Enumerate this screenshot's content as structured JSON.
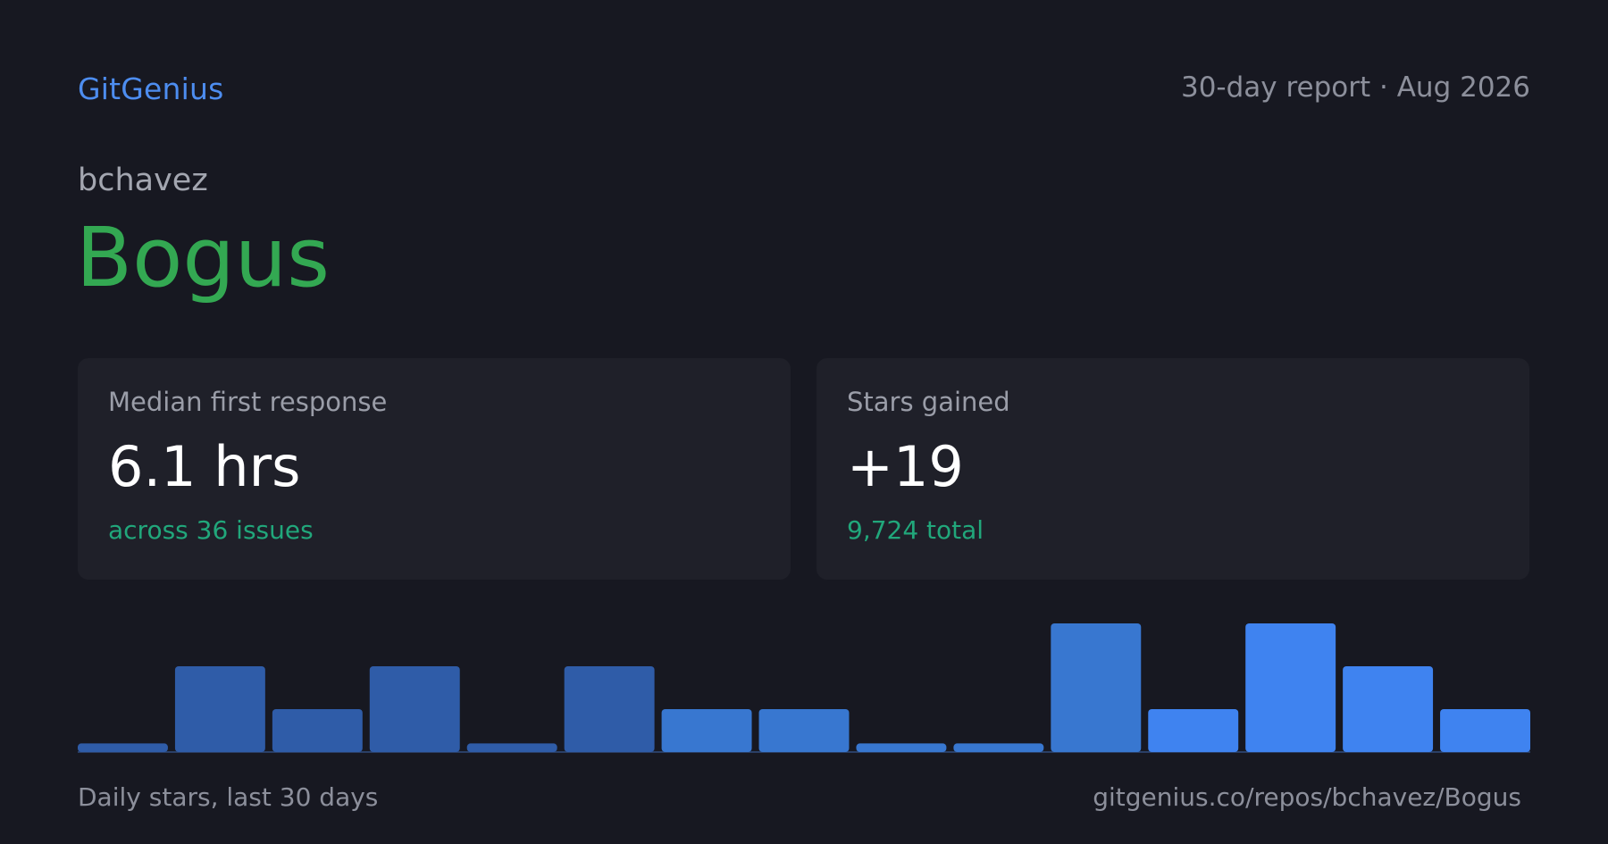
{
  "header": {
    "brand": "GitGenius",
    "report_label": "30-day report · Aug 2026"
  },
  "repo": {
    "owner": "bchavez",
    "name": "Bogus"
  },
  "stats": {
    "response": {
      "label": "Median first response",
      "value": "6.1 hrs",
      "sub": "across 36 issues"
    },
    "stars": {
      "label": "Stars gained",
      "value": "+19",
      "sub": "9,724 total"
    }
  },
  "footer": {
    "caption": "Daily stars, last 30 days",
    "url": "gitgenius.co/repos/bchavez/Bogus"
  },
  "colors": {
    "brand": "#4d8df0",
    "repo": "#33a852",
    "accent": "#21a77b",
    "bar_dark": "#2f5ca8",
    "bar_mid": "#3877d0",
    "bar_bright": "#3f83f0"
  },
  "chart_data": {
    "type": "bar",
    "values": [
      0.2,
      2,
      1,
      2,
      0.2,
      2,
      1,
      1,
      0.2,
      0.2,
      3,
      1,
      3,
      2,
      1
    ],
    "ylim": [
      0,
      3
    ],
    "bar_colors": [
      "#2f5ca8",
      "#2f5ca8",
      "#2f5ca8",
      "#2f5ca8",
      "#2f5ca8",
      "#2f5ca8",
      "#3877d0",
      "#3877d0",
      "#3877d0",
      "#3877d0",
      "#3877d0",
      "#3f83f0",
      "#3f83f0",
      "#3f83f0",
      "#3f83f0"
    ]
  }
}
